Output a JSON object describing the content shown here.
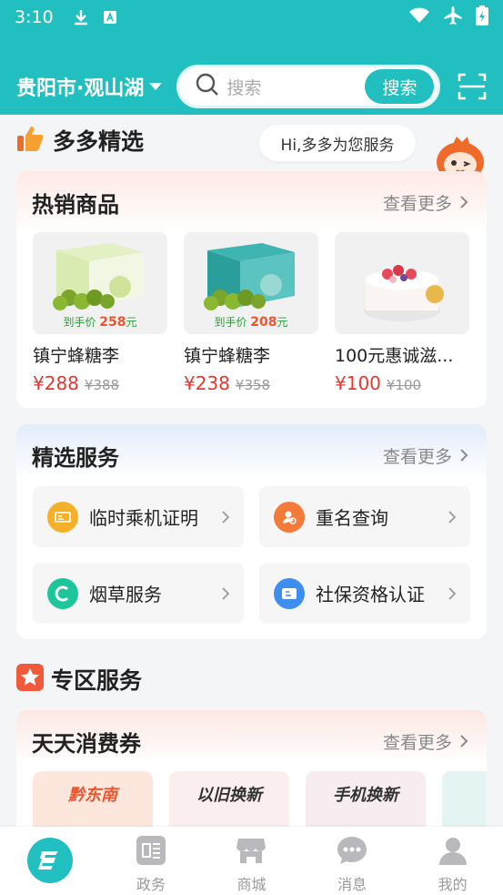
{
  "status_bar": {
    "time": "3:10"
  },
  "header": {
    "city": "贵阳市·观山湖",
    "search_placeholder": "搜索",
    "search_button": "搜索"
  },
  "duoduo": {
    "title": "多多精选",
    "bubble": "Hi,多多为您服务"
  },
  "hot": {
    "title": "热销商品",
    "more": "查看更多",
    "products": [
      {
        "name": "镇宁蜂糖李",
        "price": "¥288",
        "old_price": "¥388",
        "hand_label": "到手价",
        "hand_price": "258",
        "hand_unit": "元"
      },
      {
        "name": "镇宁蜂糖李",
        "price": "¥238",
        "old_price": "¥358",
        "hand_label": "到手价",
        "hand_price": "208",
        "hand_unit": "元"
      },
      {
        "name": "100元惠诚滋...",
        "price": "¥100",
        "old_price": "¥100"
      }
    ]
  },
  "selected": {
    "title": "精选服务",
    "more": "查看更多",
    "services": [
      {
        "label": "临时乘机证明",
        "color": "#f5b02a"
      },
      {
        "label": "重名查询",
        "color": "#f47a3a"
      },
      {
        "label": "烟草服务",
        "color": "#1cc69a"
      },
      {
        "label": "社保资格认证",
        "color": "#3e8ef0"
      }
    ]
  },
  "zone": {
    "title": "专区服务"
  },
  "coupon": {
    "title": "天天消费券",
    "more": "查看更多",
    "items": [
      "黔东南",
      "以旧换新",
      "手机换新",
      ""
    ]
  },
  "tabbar": {
    "tabs": [
      {
        "label": ""
      },
      {
        "label": "政务"
      },
      {
        "label": "商城"
      },
      {
        "label": "消息"
      },
      {
        "label": "我的"
      }
    ]
  },
  "colors": {
    "accent": "#22bfc0",
    "price": "#e8362f"
  }
}
